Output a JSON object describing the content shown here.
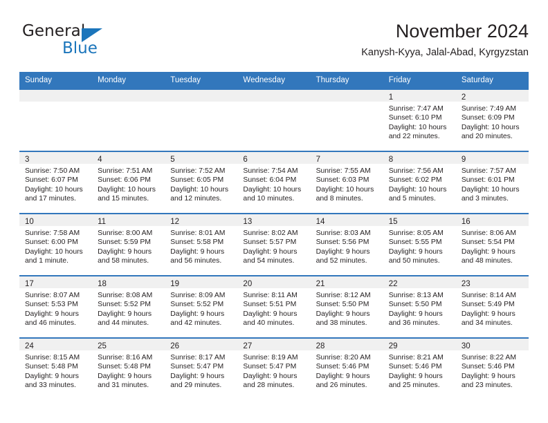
{
  "brand": {
    "name_top": "General",
    "name_bottom": "Blue",
    "accent_color": "#1b75bb"
  },
  "header": {
    "title": "November 2024",
    "subtitle": "Kanysh-Kyya, Jalal-Abad, Kyrgyzstan"
  },
  "theme": {
    "header_bg": "#3277bc",
    "day_band_bg": "#f0f0f0",
    "text_color": "#231f20"
  },
  "weekdays": [
    "Sunday",
    "Monday",
    "Tuesday",
    "Wednesday",
    "Thursday",
    "Friday",
    "Saturday"
  ],
  "weeks": [
    [
      {
        "day": "",
        "lines": []
      },
      {
        "day": "",
        "lines": []
      },
      {
        "day": "",
        "lines": []
      },
      {
        "day": "",
        "lines": []
      },
      {
        "day": "",
        "lines": []
      },
      {
        "day": "1",
        "lines": [
          "Sunrise: 7:47 AM",
          "Sunset: 6:10 PM",
          "Daylight: 10 hours",
          "and 22 minutes."
        ]
      },
      {
        "day": "2",
        "lines": [
          "Sunrise: 7:49 AM",
          "Sunset: 6:09 PM",
          "Daylight: 10 hours",
          "and 20 minutes."
        ]
      }
    ],
    [
      {
        "day": "3",
        "lines": [
          "Sunrise: 7:50 AM",
          "Sunset: 6:07 PM",
          "Daylight: 10 hours",
          "and 17 minutes."
        ]
      },
      {
        "day": "4",
        "lines": [
          "Sunrise: 7:51 AM",
          "Sunset: 6:06 PM",
          "Daylight: 10 hours",
          "and 15 minutes."
        ]
      },
      {
        "day": "5",
        "lines": [
          "Sunrise: 7:52 AM",
          "Sunset: 6:05 PM",
          "Daylight: 10 hours",
          "and 12 minutes."
        ]
      },
      {
        "day": "6",
        "lines": [
          "Sunrise: 7:54 AM",
          "Sunset: 6:04 PM",
          "Daylight: 10 hours",
          "and 10 minutes."
        ]
      },
      {
        "day": "7",
        "lines": [
          "Sunrise: 7:55 AM",
          "Sunset: 6:03 PM",
          "Daylight: 10 hours",
          "and 8 minutes."
        ]
      },
      {
        "day": "8",
        "lines": [
          "Sunrise: 7:56 AM",
          "Sunset: 6:02 PM",
          "Daylight: 10 hours",
          "and 5 minutes."
        ]
      },
      {
        "day": "9",
        "lines": [
          "Sunrise: 7:57 AM",
          "Sunset: 6:01 PM",
          "Daylight: 10 hours",
          "and 3 minutes."
        ]
      }
    ],
    [
      {
        "day": "10",
        "lines": [
          "Sunrise: 7:58 AM",
          "Sunset: 6:00 PM",
          "Daylight: 10 hours",
          "and 1 minute."
        ]
      },
      {
        "day": "11",
        "lines": [
          "Sunrise: 8:00 AM",
          "Sunset: 5:59 PM",
          "Daylight: 9 hours",
          "and 58 minutes."
        ]
      },
      {
        "day": "12",
        "lines": [
          "Sunrise: 8:01 AM",
          "Sunset: 5:58 PM",
          "Daylight: 9 hours",
          "and 56 minutes."
        ]
      },
      {
        "day": "13",
        "lines": [
          "Sunrise: 8:02 AM",
          "Sunset: 5:57 PM",
          "Daylight: 9 hours",
          "and 54 minutes."
        ]
      },
      {
        "day": "14",
        "lines": [
          "Sunrise: 8:03 AM",
          "Sunset: 5:56 PM",
          "Daylight: 9 hours",
          "and 52 minutes."
        ]
      },
      {
        "day": "15",
        "lines": [
          "Sunrise: 8:05 AM",
          "Sunset: 5:55 PM",
          "Daylight: 9 hours",
          "and 50 minutes."
        ]
      },
      {
        "day": "16",
        "lines": [
          "Sunrise: 8:06 AM",
          "Sunset: 5:54 PM",
          "Daylight: 9 hours",
          "and 48 minutes."
        ]
      }
    ],
    [
      {
        "day": "17",
        "lines": [
          "Sunrise: 8:07 AM",
          "Sunset: 5:53 PM",
          "Daylight: 9 hours",
          "and 46 minutes."
        ]
      },
      {
        "day": "18",
        "lines": [
          "Sunrise: 8:08 AM",
          "Sunset: 5:52 PM",
          "Daylight: 9 hours",
          "and 44 minutes."
        ]
      },
      {
        "day": "19",
        "lines": [
          "Sunrise: 8:09 AM",
          "Sunset: 5:52 PM",
          "Daylight: 9 hours",
          "and 42 minutes."
        ]
      },
      {
        "day": "20",
        "lines": [
          "Sunrise: 8:11 AM",
          "Sunset: 5:51 PM",
          "Daylight: 9 hours",
          "and 40 minutes."
        ]
      },
      {
        "day": "21",
        "lines": [
          "Sunrise: 8:12 AM",
          "Sunset: 5:50 PM",
          "Daylight: 9 hours",
          "and 38 minutes."
        ]
      },
      {
        "day": "22",
        "lines": [
          "Sunrise: 8:13 AM",
          "Sunset: 5:50 PM",
          "Daylight: 9 hours",
          "and 36 minutes."
        ]
      },
      {
        "day": "23",
        "lines": [
          "Sunrise: 8:14 AM",
          "Sunset: 5:49 PM",
          "Daylight: 9 hours",
          "and 34 minutes."
        ]
      }
    ],
    [
      {
        "day": "24",
        "lines": [
          "Sunrise: 8:15 AM",
          "Sunset: 5:48 PM",
          "Daylight: 9 hours",
          "and 33 minutes."
        ]
      },
      {
        "day": "25",
        "lines": [
          "Sunrise: 8:16 AM",
          "Sunset: 5:48 PM",
          "Daylight: 9 hours",
          "and 31 minutes."
        ]
      },
      {
        "day": "26",
        "lines": [
          "Sunrise: 8:17 AM",
          "Sunset: 5:47 PM",
          "Daylight: 9 hours",
          "and 29 minutes."
        ]
      },
      {
        "day": "27",
        "lines": [
          "Sunrise: 8:19 AM",
          "Sunset: 5:47 PM",
          "Daylight: 9 hours",
          "and 28 minutes."
        ]
      },
      {
        "day": "28",
        "lines": [
          "Sunrise: 8:20 AM",
          "Sunset: 5:46 PM",
          "Daylight: 9 hours",
          "and 26 minutes."
        ]
      },
      {
        "day": "29",
        "lines": [
          "Sunrise: 8:21 AM",
          "Sunset: 5:46 PM",
          "Daylight: 9 hours",
          "and 25 minutes."
        ]
      },
      {
        "day": "30",
        "lines": [
          "Sunrise: 8:22 AM",
          "Sunset: 5:46 PM",
          "Daylight: 9 hours",
          "and 23 minutes."
        ]
      }
    ]
  ]
}
